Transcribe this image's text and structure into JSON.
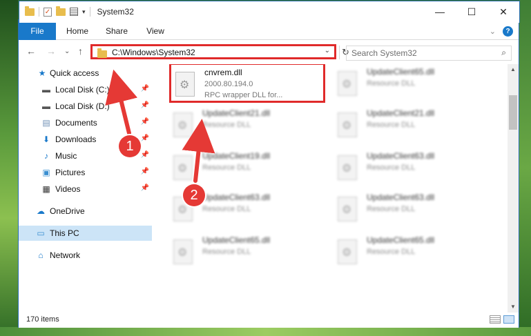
{
  "window": {
    "title": "System32",
    "controls": {
      "minimize": "—",
      "maximize": "☐",
      "close": "✕"
    }
  },
  "ribbon": {
    "tabs": [
      "File",
      "Home",
      "Share",
      "View"
    ],
    "help": "?",
    "collapse": "⌄"
  },
  "navigation": {
    "back": "←",
    "forward": "→",
    "recent": "⌄",
    "up": "↑",
    "address": "C:\\Windows\\System32",
    "dropdown": "⌄",
    "refresh": "↻",
    "search_placeholder": "Search System32",
    "search_icon": "⌕"
  },
  "sidebar": {
    "items": [
      {
        "label": "Quick access",
        "icon": "star-icon",
        "glyph": "★",
        "pinned": false
      },
      {
        "label": "Local Disk (C:)",
        "icon": "drive-icon",
        "glyph": "▬",
        "pinned": true
      },
      {
        "label": "Local Disk (D:)",
        "icon": "drive-icon",
        "glyph": "▬",
        "pinned": true
      },
      {
        "label": "Documents",
        "icon": "documents-icon",
        "glyph": "▤",
        "pinned": true
      },
      {
        "label": "Downloads",
        "icon": "downloads-icon",
        "glyph": "⬇",
        "pinned": true
      },
      {
        "label": "Music",
        "icon": "music-icon",
        "glyph": "♪",
        "pinned": true
      },
      {
        "label": "Pictures",
        "icon": "pictures-icon",
        "glyph": "▣",
        "pinned": true
      },
      {
        "label": "Videos",
        "icon": "videos-icon",
        "glyph": "▦",
        "pinned": true
      },
      {
        "label": "OneDrive",
        "icon": "onedrive-icon",
        "glyph": "☁",
        "pinned": false
      },
      {
        "label": "This PC",
        "icon": "computer-icon",
        "glyph": "▭",
        "pinned": false,
        "selected": true
      },
      {
        "label": "Network",
        "icon": "network-icon",
        "glyph": "⌂",
        "pinned": false
      }
    ],
    "pin_glyph": "📌"
  },
  "files": [
    {
      "name": "cnvrem.dll",
      "line2": "2000.80.194.0",
      "line3": "RPC wrapper DLL for...",
      "highlighted": true
    },
    {
      "name": "UpdateClient65.dll",
      "line2": "Resource DLL",
      "line3": ""
    },
    {
      "name": "UpdateClient21.dll",
      "line2": "Resource DLL",
      "line3": ""
    },
    {
      "name": "UpdateClient21.dll",
      "line2": "Resource DLL",
      "line3": ""
    },
    {
      "name": "UpdateClient19.dll",
      "line2": "Resource DLL",
      "line3": ""
    },
    {
      "name": "UpdateClient63.dll",
      "line2": "Resource DLL",
      "line3": ""
    },
    {
      "name": "UpdateClient63.dll",
      "line2": "Resource DLL",
      "line3": ""
    },
    {
      "name": "UpdateClient63.dll",
      "line2": "Resource DLL",
      "line3": ""
    },
    {
      "name": "UpdateClient65.dll",
      "line2": "Resource DLL",
      "line3": ""
    },
    {
      "name": "UpdateClient65.dll",
      "line2": "Resource DLL",
      "line3": ""
    }
  ],
  "status": {
    "item_count": "170 items"
  },
  "annotations": {
    "callout1": "1",
    "callout2": "2",
    "color": "#e53935"
  }
}
